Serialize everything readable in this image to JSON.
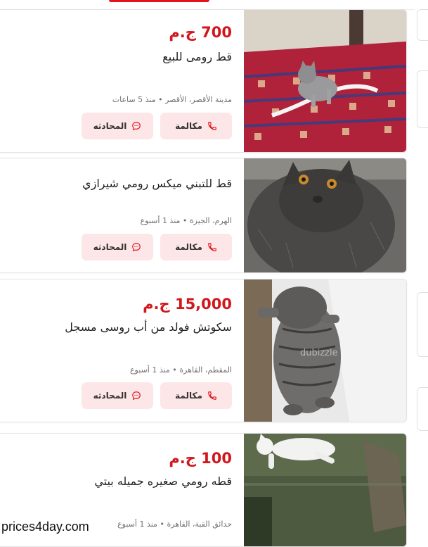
{
  "listings": [
    {
      "price": "700 ج.م",
      "title": "قط رومى للبيع",
      "location": "مدينة الأقصر، الأقصر",
      "time": "منذ 5 ساعات",
      "call_label": "مكالمة",
      "chat_label": "المحادثه"
    },
    {
      "price": "",
      "title": "قط للتبني ميكس رومي شيرازي",
      "location": "الهرم، الجيزة",
      "time": "منذ 1 أسبوع",
      "call_label": "مكالمة",
      "chat_label": "المحادثه"
    },
    {
      "price": "15,000 ج.م",
      "title": "سكوتش فولد من أب روسى مسجل",
      "location": "المقطم، القاهرة",
      "time": "منذ 1 أسبوع",
      "call_label": "مكالمة",
      "chat_label": "المحادثه"
    },
    {
      "price": "100 ج.م",
      "title": "قطه رومي صغيره جميله بيتي",
      "location": "حدائق القبة، القاهرة",
      "time": "منذ 1 أسبوع",
      "call_label": "مكالمة",
      "chat_label": "المحادثه"
    }
  ],
  "photo_watermark": "dubizzle",
  "site_watermark": "prices4day.com",
  "colors": {
    "price": "#d2161c",
    "button_bg": "#fde6e7",
    "icon": "#e2151b"
  }
}
